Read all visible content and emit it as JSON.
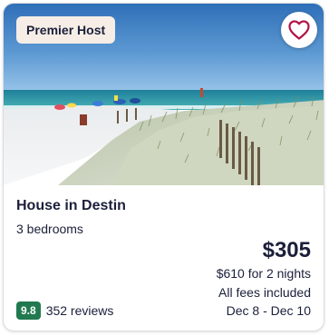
{
  "listing": {
    "badge": "Premier Host",
    "title": "House in Destin",
    "bedrooms": "3 bedrooms",
    "price": "$305",
    "total": "$610 for 2 nights",
    "fees": "All fees included",
    "dates": "Dec 8 - Dec 10",
    "rating": "9.8",
    "reviews": "352 reviews"
  },
  "colors": {
    "heart": "#b01548",
    "rating_badge": "#227950",
    "badge_bg": "#f6ede6",
    "text": "#1b1f3a"
  },
  "icons": {
    "favorite": "heart-outline-icon"
  }
}
